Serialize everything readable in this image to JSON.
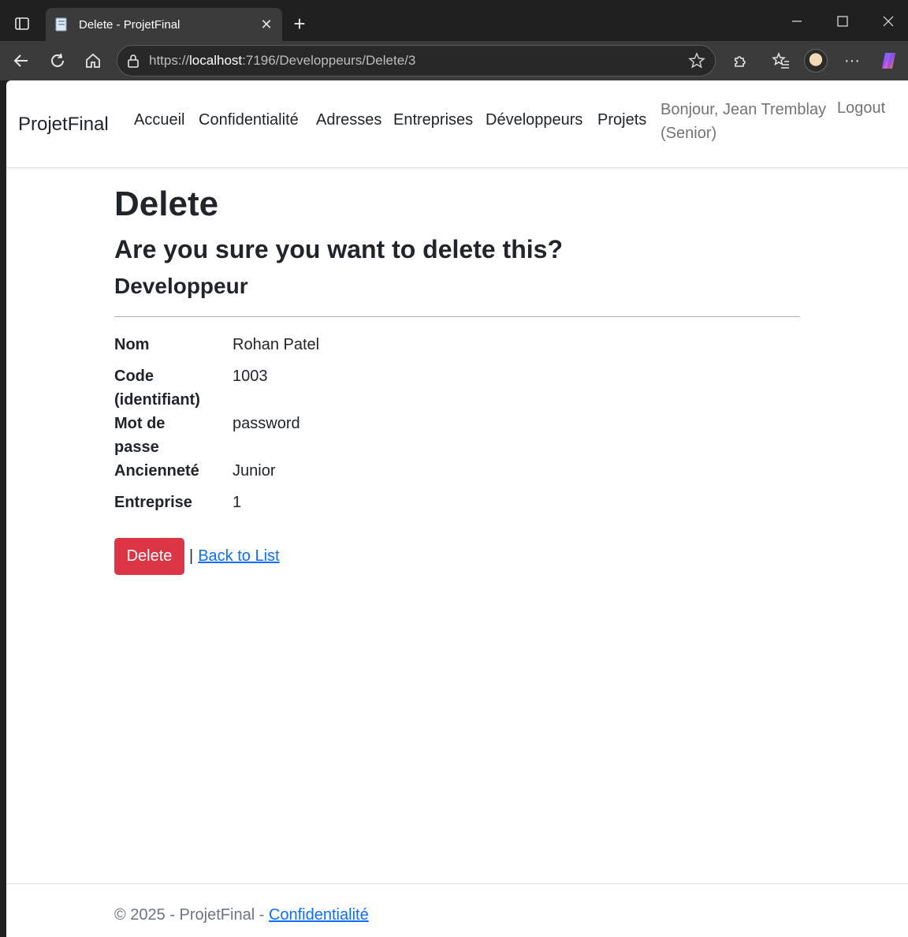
{
  "browser": {
    "tab_title": "Delete - ProjetFinal",
    "url_scheme": "https://",
    "url_host": "localhost",
    "url_path": ":7196/Developpeurs/Delete/3"
  },
  "navbar": {
    "brand": "ProjetFinal",
    "links": [
      "Accueil",
      "Confidentialité",
      "Adresses",
      "Entreprises",
      "Développeurs",
      "Projets"
    ],
    "greeting_line1": "Bonjour, Jean Tremblay",
    "greeting_line2": "(Senior)",
    "logout": "Logout"
  },
  "main": {
    "title": "Delete",
    "question": "Are you sure you want to delete this?",
    "entity": "Developpeur",
    "fields": [
      {
        "label_lines": [
          "Nom"
        ],
        "value": "Rohan Patel"
      },
      {
        "label_lines": [
          "Code",
          "(identifiant)"
        ],
        "value": "1003"
      },
      {
        "label_lines": [
          "Mot de",
          "passe"
        ],
        "value": "password"
      },
      {
        "label_lines": [
          "Ancienneté"
        ],
        "value": "Junior"
      },
      {
        "label_lines": [
          "Entreprise"
        ],
        "value": "1"
      }
    ],
    "delete_button": "Delete",
    "separator": "|",
    "back_link": "Back to List"
  },
  "footer": {
    "text": "© 2025 - ProjetFinal - ",
    "link": "Confidentialité"
  }
}
